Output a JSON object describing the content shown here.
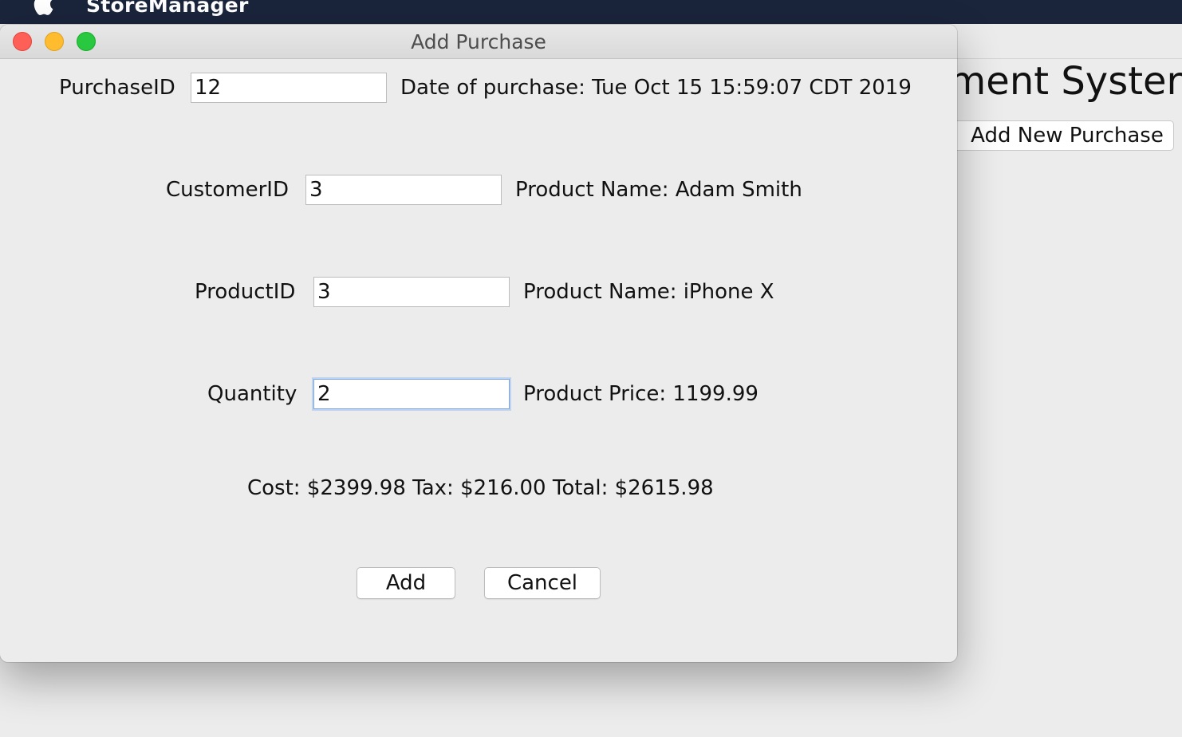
{
  "menubar": {
    "app_name": "StoreManager"
  },
  "background_window": {
    "heading_fragment": "ement Syster",
    "add_new_purchase_button": "Add New Purchase"
  },
  "dialog": {
    "title": "Add Purchase",
    "purchase_id": {
      "label": "PurchaseID",
      "value": "12"
    },
    "date_info": "Date of purchase: Tue Oct 15 15:59:07 CDT 2019",
    "customer_id": {
      "label": "CustomerID",
      "value": "3"
    },
    "customer_info": "Product Name: Adam Smith",
    "product_id": {
      "label": "ProductID",
      "value": "3"
    },
    "product_info": "Product Name: iPhone X",
    "quantity": {
      "label": "Quantity",
      "value": "2"
    },
    "price_info": "Product Price: 1199.99",
    "totals": "Cost: $2399.98 Tax: $216.00 Total: $2615.98",
    "add_button": "Add",
    "cancel_button": "Cancel"
  },
  "colors": {
    "menubar_bg": "#1a243b",
    "window_bg": "#ececec",
    "close": "#fe5f57",
    "minimize": "#febc2e",
    "maximize": "#28c840",
    "focus_ring": "#78a7e6"
  },
  "icons": [
    "apple-logo-icon",
    "close-window-icon",
    "minimize-window-icon",
    "maximize-window-icon"
  ]
}
